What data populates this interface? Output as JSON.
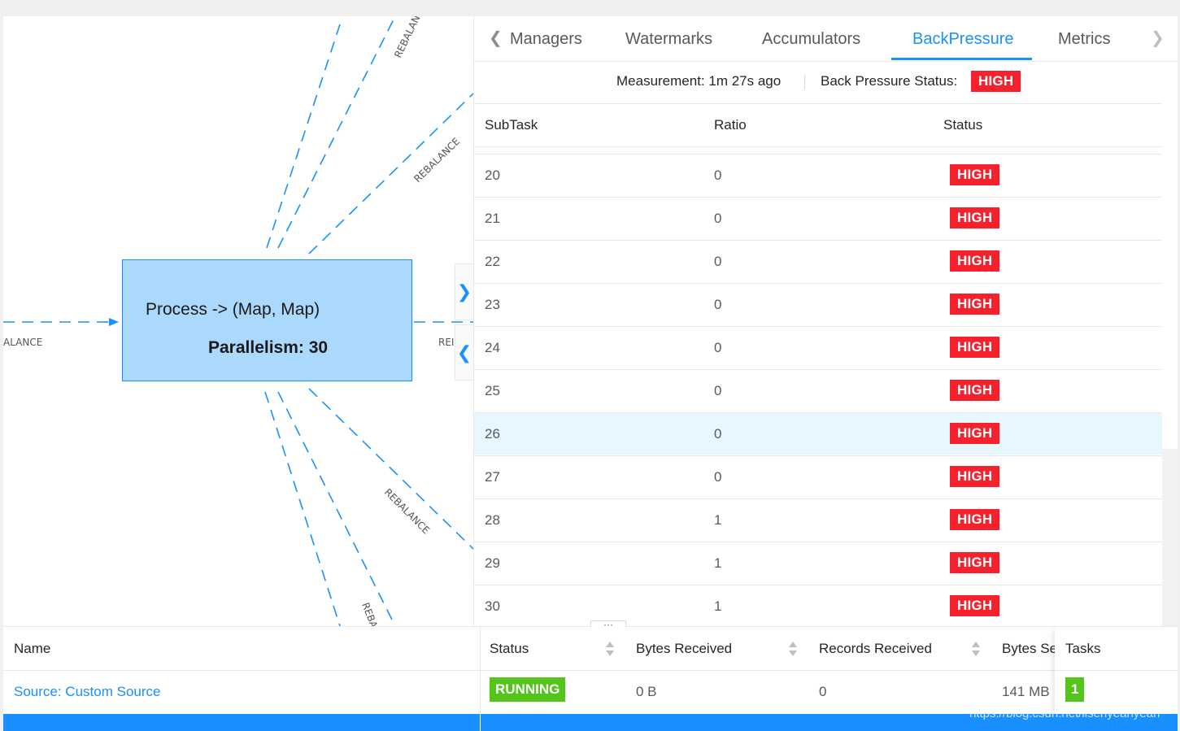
{
  "graph": {
    "node": {
      "title": "Process -> (Map, Map)",
      "parallelism": "Parallelism: 30"
    },
    "edge_label": "REBALANCE",
    "edge_label_left_partial": "ALANCE",
    "edge_label_right_partial": "REI"
  },
  "panel": {
    "tabs": [
      "Managers",
      "Watermarks",
      "Accumulators",
      "BackPressure",
      "Metrics"
    ],
    "active_tab": "BackPressure",
    "measurement": "Measurement: 1m 27s ago",
    "status_label": "Back Pressure Status:",
    "status_value": "HIGH",
    "columns": [
      "SubTask",
      "Ratio",
      "Status"
    ],
    "rows": [
      {
        "subtask": "20",
        "ratio": "0",
        "status": "HIGH"
      },
      {
        "subtask": "21",
        "ratio": "0",
        "status": "HIGH"
      },
      {
        "subtask": "22",
        "ratio": "0",
        "status": "HIGH"
      },
      {
        "subtask": "23",
        "ratio": "0",
        "status": "HIGH"
      },
      {
        "subtask": "24",
        "ratio": "0",
        "status": "HIGH"
      },
      {
        "subtask": "25",
        "ratio": "0",
        "status": "HIGH"
      },
      {
        "subtask": "26",
        "ratio": "0",
        "status": "HIGH"
      },
      {
        "subtask": "27",
        "ratio": "0",
        "status": "HIGH"
      },
      {
        "subtask": "28",
        "ratio": "1",
        "status": "HIGH"
      },
      {
        "subtask": "29",
        "ratio": "1",
        "status": "HIGH"
      },
      {
        "subtask": "30",
        "ratio": "1",
        "status": "HIGH"
      }
    ],
    "highlighted_subtask": "26"
  },
  "splitter": {
    "handle": "···"
  },
  "bottom": {
    "columns": [
      "Name",
      "Status",
      "Bytes Received",
      "Records Received",
      "Bytes Se",
      "Tasks"
    ],
    "row": {
      "name": "Source: Custom Source",
      "status": "RUNNING",
      "bytes_received": "0 B",
      "records_received": "0",
      "bytes_sent": "141 MB",
      "tasks": "1"
    }
  },
  "watermark": "https://blog.csdn.net/lisenyeahyeah",
  "colors": {
    "accent": "#1890ff",
    "high": "#f5222d",
    "running": "#52c41a",
    "node_fill": "#abd8fd"
  }
}
